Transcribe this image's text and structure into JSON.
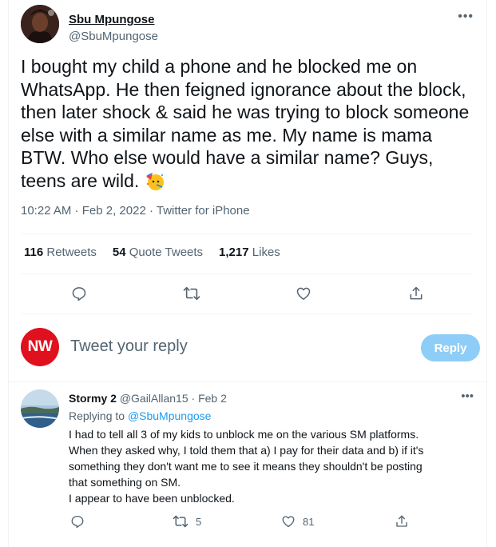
{
  "tweet": {
    "author_name": "Sbu Mpungose",
    "author_handle": "@SbuMpungose",
    "text": "I bought my child a phone and he blocked me on WhatsApp. He then feigned ignorance about the block, then later shock & said he was trying to block someone else with a similar name as me. My name is mama BTW. Who else would have a similar name? Guys, teens are wild. ",
    "time": "10:22 AM",
    "date": "Feb 2, 2022",
    "source": "Twitter for iPhone",
    "stats": {
      "retweets_count": "116",
      "retweets_label": "Retweets",
      "quotes_count": "54",
      "quotes_label": "Quote Tweets",
      "likes_count": "1,217",
      "likes_label": "Likes"
    },
    "icons": [
      "more-icon",
      "party-face-emoji",
      "reply-icon",
      "retweet-icon",
      "like-icon",
      "share-icon"
    ]
  },
  "composer": {
    "avatar_text": "NW",
    "placeholder": "Tweet your reply",
    "button_label": "Reply",
    "colors": {
      "avatar": "#e0101e",
      "button": "#8ecdf7"
    }
  },
  "reply": {
    "author_name": "Stormy 2",
    "author_handle": "@GailAllan15",
    "date": "Feb 2",
    "replying_prefix": "Replying to",
    "replying_to": "@SbuMpungose",
    "lines": [
      "I had to tell all 3 of my kids to unblock me on the various SM platforms.",
      "When they asked why, I told them that a) I pay for their data and b) if it's",
      "something they don't want me to see it means they shouldn't be posting",
      "that something on SM.",
      "I appear to have been unblocked."
    ],
    "retweets": "5",
    "likes": "81"
  },
  "colors": {
    "accent": "#1d9bf0",
    "text": "#0f1419",
    "muted": "#536471"
  }
}
